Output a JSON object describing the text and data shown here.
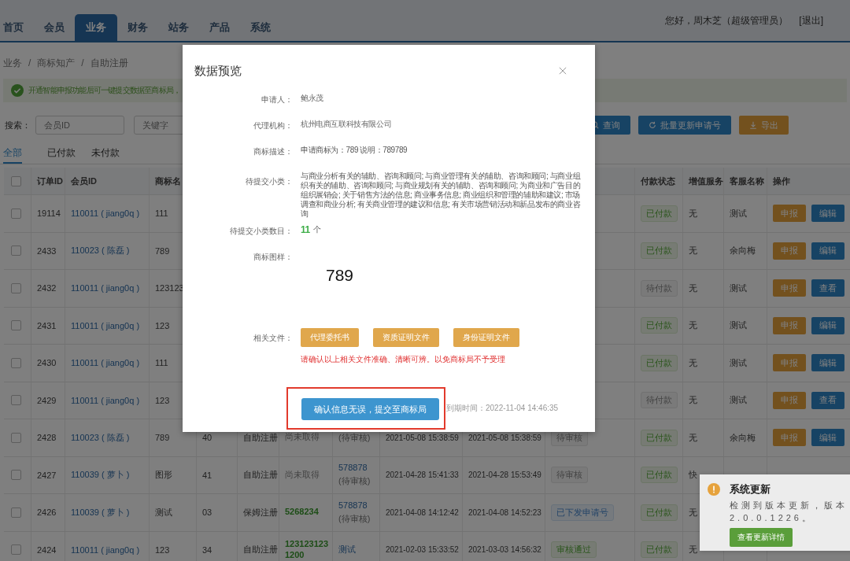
{
  "nav": {
    "tabs": [
      {
        "label": "首页",
        "selected": false
      },
      {
        "label": "会员",
        "selected": false
      },
      {
        "label": "业务",
        "selected": true
      },
      {
        "label": "财务",
        "selected": false
      },
      {
        "label": "站务",
        "selected": false
      },
      {
        "label": "产品",
        "selected": false
      },
      {
        "label": "系统",
        "selected": false
      }
    ],
    "greeting": "您好，周木芝（超级管理员）",
    "logout": "[退出]"
  },
  "breadcrumb": {
    "items": [
      "业务",
      "商标知产",
      "自助注册"
    ],
    "separator": "/"
  },
  "alert": {
    "text": "开通智能申报功能后可一键提交数据至商标局，"
  },
  "search": {
    "label": "搜索：",
    "fields": [
      {
        "placeholder": "会员ID"
      },
      {
        "placeholder": "关键字"
      }
    ],
    "buttons": [
      {
        "label": "查询",
        "kind": "search"
      },
      {
        "label": "批量更新申请号",
        "kind": "refresh"
      },
      {
        "label": "导出",
        "kind": "export"
      }
    ]
  },
  "filter_tabs": [
    {
      "label": "全部",
      "selected": true
    },
    {
      "label": "已付款",
      "selected": false
    },
    {
      "label": "未付款",
      "selected": false
    }
  ],
  "table": {
    "header_checked": false,
    "columns": [
      "订单ID",
      "会员ID",
      "商标名",
      null,
      null,
      null,
      null,
      null,
      null,
      null,
      "付款状态",
      "增值服务",
      "客服名称",
      "操作"
    ],
    "rows": [
      {
        "checked": false,
        "order_id": "19114",
        "member": "110011 ( jiang0q )",
        "name": "111",
        "payment": {
          "label": "已付款",
          "kind": "paid"
        },
        "service": "无",
        "agent": "测试",
        "actions": [
          {
            "label": "申报",
            "kind": "report"
          },
          {
            "label": "编辑",
            "kind": "edit"
          }
        ]
      },
      {
        "checked": false,
        "order_id": "2433",
        "member": "110023 ( 陈磊 )",
        "name": "789",
        "payment": {
          "label": "已付款",
          "kind": "paid"
        },
        "service": "无",
        "agent": "余向梅",
        "actions": [
          {
            "label": "申报",
            "kind": "report"
          },
          {
            "label": "编辑",
            "kind": "edit"
          }
        ]
      },
      {
        "checked": false,
        "order_id": "2432",
        "member": "110011 ( jiang0q )",
        "name": "123123",
        "payment": {
          "label": "待付款",
          "kind": "unpaid"
        },
        "service": "无",
        "agent": "测试",
        "actions": [
          {
            "label": "申报",
            "kind": "report"
          },
          {
            "label": "查看",
            "kind": "view"
          }
        ]
      },
      {
        "checked": false,
        "order_id": "2431",
        "member": "110011 ( jiang0q )",
        "name": "123",
        "payment": {
          "label": "已付款",
          "kind": "paid"
        },
        "service": "无",
        "agent": "测试",
        "actions": [
          {
            "label": "申报",
            "kind": "report"
          },
          {
            "label": "编辑",
            "kind": "edit"
          }
        ]
      },
      {
        "checked": false,
        "order_id": "2430",
        "member": "110011 ( jiang0q )",
        "name": "111",
        "payment": {
          "label": "已付款",
          "kind": "paid"
        },
        "service": "无",
        "agent": "测试",
        "actions": [
          {
            "label": "申报",
            "kind": "report"
          },
          {
            "label": "编辑",
            "kind": "edit"
          }
        ]
      },
      {
        "checked": false,
        "order_id": "2429",
        "member": "110011 ( jiang0q )",
        "name": "123",
        "payment": {
          "label": "待付款",
          "kind": "unpaid"
        },
        "service": "无",
        "agent": "测试",
        "actions": [
          {
            "label": "申报",
            "kind": "report"
          },
          {
            "label": "查看",
            "kind": "view"
          }
        ]
      },
      {
        "checked": false,
        "order_id": "2428",
        "member": "110023 ( 陈磊 )",
        "name": "789",
        "category": "40",
        "method": "自助注册",
        "app_no": {
          "text": "尚未取得",
          "kind": "none"
        },
        "mark": {
          "note": "(待审核)"
        },
        "created": "2021-05-08 15:38:59",
        "updated": "2021-05-08 15:38:59",
        "status": {
          "label": "待审核",
          "kind": "pending"
        },
        "payment": {
          "label": "已付款",
          "kind": "paid"
        },
        "service": "无",
        "agent": "余向梅",
        "actions": [
          {
            "label": "申报",
            "kind": "report"
          },
          {
            "label": "编辑",
            "kind": "edit"
          }
        ]
      },
      {
        "checked": false,
        "order_id": "2427",
        "member": "110039 ( 萝卜 )",
        "name": "图形",
        "category": "41",
        "method": "自助注册",
        "app_no": {
          "text": "尚未取得",
          "kind": "none"
        },
        "mark": {
          "text": "578878",
          "note": "(待审核)"
        },
        "created": "2021-04-28 15:41:33",
        "updated": "2021-04-28 15:53:49",
        "status": {
          "label": "待审核",
          "kind": "pending"
        },
        "payment": {
          "label": "已付款",
          "kind": "paid"
        },
        "service": "快"
      },
      {
        "checked": false,
        "order_id": "2426",
        "member": "110039 ( 萝卜 )",
        "name": "测试",
        "category": "03",
        "method": "保姆注册",
        "app_no": {
          "text": "5268234",
          "kind": "issued"
        },
        "mark": {
          "text": "578878",
          "note": "(待审核)"
        },
        "created": "2021-04-08 14:12:42",
        "updated": "2021-04-08 14:52:23",
        "status": {
          "label": "已下发申请号",
          "kind": "issued"
        },
        "payment": {
          "label": "已付款",
          "kind": "paid"
        },
        "service": "无"
      },
      {
        "checked": false,
        "order_id": "2424",
        "member": "110011 ( jiang0q )",
        "name": "123",
        "category": "34",
        "method": "自助注册",
        "app_no": {
          "text": "1231231231200",
          "kind": "issued"
        },
        "mark": {
          "text": "测试"
        },
        "created": "2021-02-03 15:33:52",
        "updated": "2021-03-03 14:56:32",
        "status": {
          "label": "审核通过",
          "kind": "approved"
        },
        "payment": {
          "label": "已付款",
          "kind": "paid"
        },
        "service": "无"
      }
    ]
  },
  "dialog": {
    "title": "数据预览",
    "fields": [
      {
        "label": "申请人：",
        "value": "鲍永茂"
      },
      {
        "label": "代理机构：",
        "value": "杭州电商互联科技有限公司"
      },
      {
        "label": "商标描述：",
        "value": "申请商标为：789 说明：789789"
      },
      {
        "label": "待提交小类：",
        "value": "与商业分析有关的辅助、咨询和顾问; 与商业管理有关的辅助、咨询和顾问; 与商业组织有关的辅助、咨询和顾问; 与商业规划有关的辅助、咨询和顾问; 为商业和广告目的组织展销会; 关于销售方法的信息; 商业事务信息; 商业组织和管理的辅助和建议; 市场调查和商业分析; 有关商业管理的建议和信息; 有关市场营销活动和新品发布的商业咨询"
      }
    ],
    "count": {
      "label": "待提交小类数目：",
      "value": "11",
      "unit": "个"
    },
    "sample": {
      "label": "商标图样：",
      "text": "789"
    },
    "files": {
      "label": "相关文件：",
      "buttons": [
        "代理委托书",
        "资质证明文件",
        "身份证明文件"
      ],
      "warning": "请确认以上相关文件准确、清晰可辨。以免商标局不予受理"
    },
    "confirm": {
      "label": "确认信息无误，提交至商标局",
      "highlighted": true
    },
    "expiry": "到期时间：2022-11-04 14:46:35"
  },
  "notification": {
    "title": "系统更新",
    "body": "检测到版本更新，版本2.0.0.1226。",
    "button": "查看更新详情"
  }
}
